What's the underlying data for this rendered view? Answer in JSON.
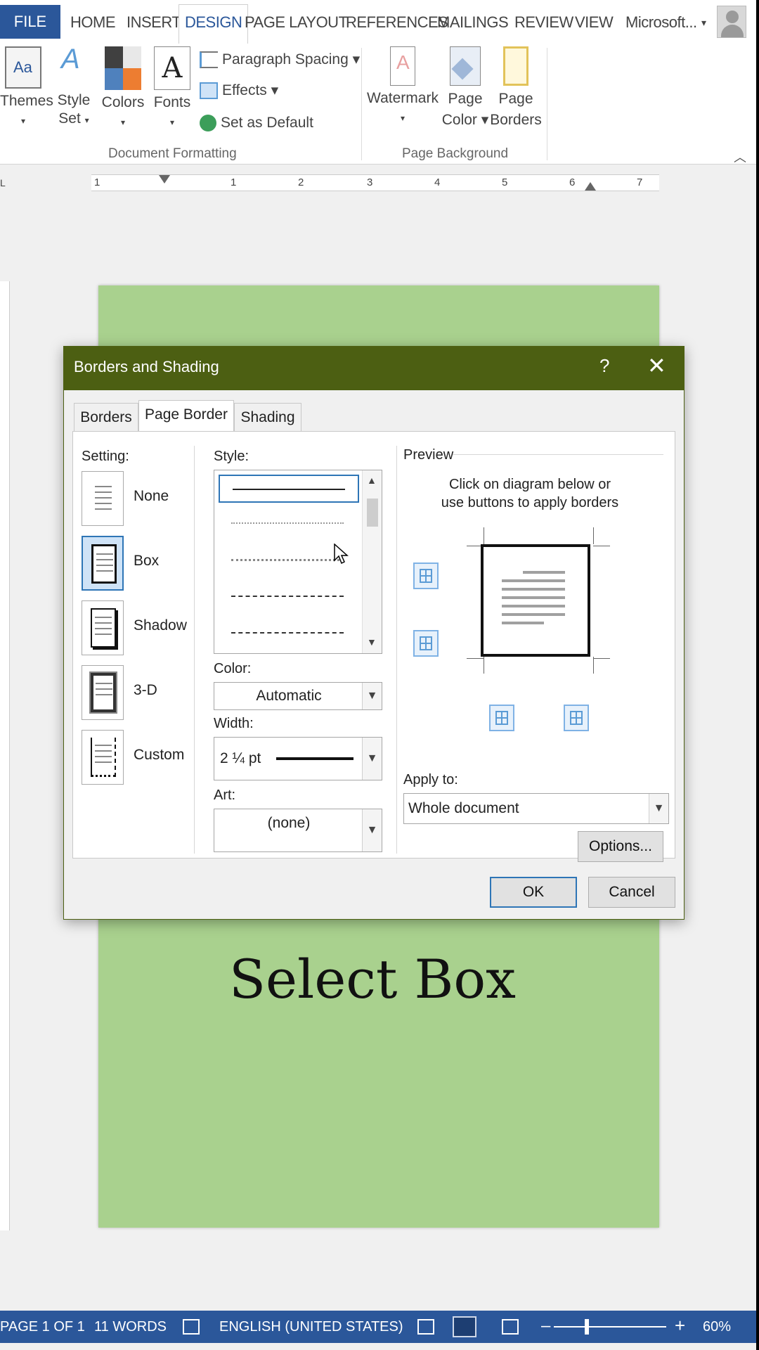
{
  "ribbon_tabs": {
    "file": "FILE",
    "home": "HOME",
    "insert": "INSERT",
    "design": "DESIGN",
    "page_layout": "PAGE LAYOUT",
    "references": "REFERENCES",
    "mailings": "MAILINGS",
    "review": "REVIEW",
    "view": "VIEW",
    "account": "Microsoft...",
    "account_arrow": "▾"
  },
  "ribbon": {
    "themes": "Themes",
    "style_set": "Style Set",
    "style_set_arrow": "▾",
    "colors": "Colors",
    "fonts": "Fonts",
    "fonts_glyph": "A",
    "paragraph_spacing": "Paragraph Spacing ▾",
    "effects": "Effects ▾",
    "set_as_default": "Set as Default",
    "group_document_formatting": "Document Formatting",
    "watermark": "Watermark",
    "page_color": "Page Color ▾",
    "page_borders": "Page Borders",
    "group_page_background": "Page Background",
    "dropdown_arrow": "▾"
  },
  "ruler": {
    "numbers": [
      "1",
      "1",
      "2",
      "3",
      "4",
      "5",
      "6",
      "7"
    ]
  },
  "dialog": {
    "title": "Borders and Shading",
    "help": "?",
    "close": "✕",
    "tabs": {
      "borders": "Borders",
      "page_border": "Page Border",
      "shading": "Shading"
    },
    "setting_label": "Setting:",
    "settings": {
      "none": "None",
      "box": "Box",
      "shadow": "Shadow",
      "three_d": "3-D",
      "custom": "Custom"
    },
    "selected_setting": "Box",
    "style_label": "Style:",
    "color_label": "Color:",
    "color_value": "Automatic",
    "width_label": "Width:",
    "width_value": "2 ¼ pt",
    "art_label": "Art:",
    "art_value": "(none)",
    "preview_label": "Preview",
    "preview_hint_1": "Click on diagram below or",
    "preview_hint_2": "use buttons to apply borders",
    "apply_to_label": "Apply to:",
    "apply_to_value": "Whole document",
    "options_button": "Options...",
    "ok_button": "OK",
    "cancel_button": "Cancel",
    "arrows": {
      "up": "▲",
      "down": "▼",
      "combo": "▼"
    }
  },
  "caption": "Select Box",
  "status_bar": {
    "page": "PAGE 1 OF 1",
    "words": "11 WORDS",
    "language": "ENGLISH (UNITED STATES)",
    "zoom_minus": "–",
    "zoom_plus": "+",
    "zoom": "60%",
    "zoom_fraction": 0.6
  },
  "colors": {
    "ribbon_accent": "#2b579a",
    "dialog_titlebar": "#4c5f12",
    "page_fill": "#a9d18e",
    "selection_blue": "#2e75b6"
  }
}
